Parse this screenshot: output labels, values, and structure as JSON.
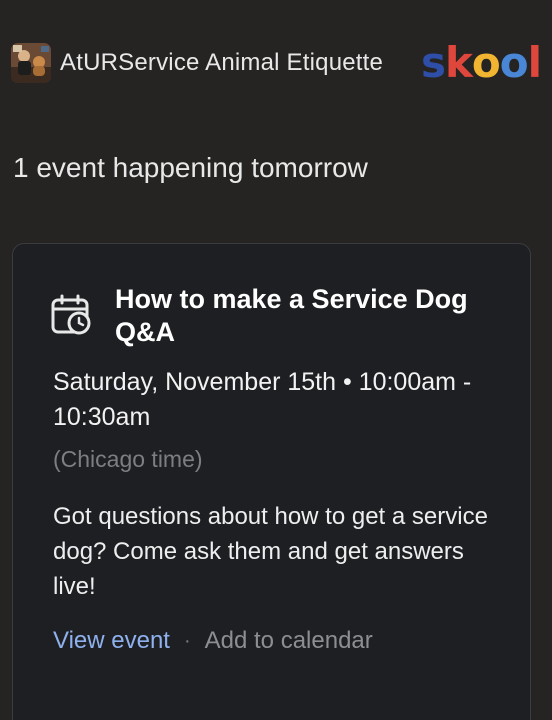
{
  "header": {
    "community_name": "AtURService Animal Etiquette",
    "logo_letters": [
      {
        "char": "s",
        "color": "#2e4ea8"
      },
      {
        "char": "k",
        "color": "#e0473c"
      },
      {
        "char": "o",
        "color": "#f2b531"
      },
      {
        "char": "o",
        "color": "#4a86d6"
      },
      {
        "char": "l",
        "color": "#e0473c"
      }
    ],
    "avatar_icon": "community-photo"
  },
  "headline": "1 event happening tomorrow",
  "event": {
    "icon": "calendar-clock-icon",
    "title": "How to make a Service Dog Q&A",
    "when": "Saturday, November 15th • 10:00am - 10:30am",
    "timezone": "(Chicago time)",
    "description": "Got questions about how to get a service dog? Come ask them and get answers live!",
    "view_label": "View event",
    "separator": "·",
    "add_calendar_label": "Add to calendar"
  },
  "colors": {
    "background": "#262423",
    "card": "#1e1f22",
    "link": "#8fb1ee",
    "muted": "#7d7e82"
  }
}
